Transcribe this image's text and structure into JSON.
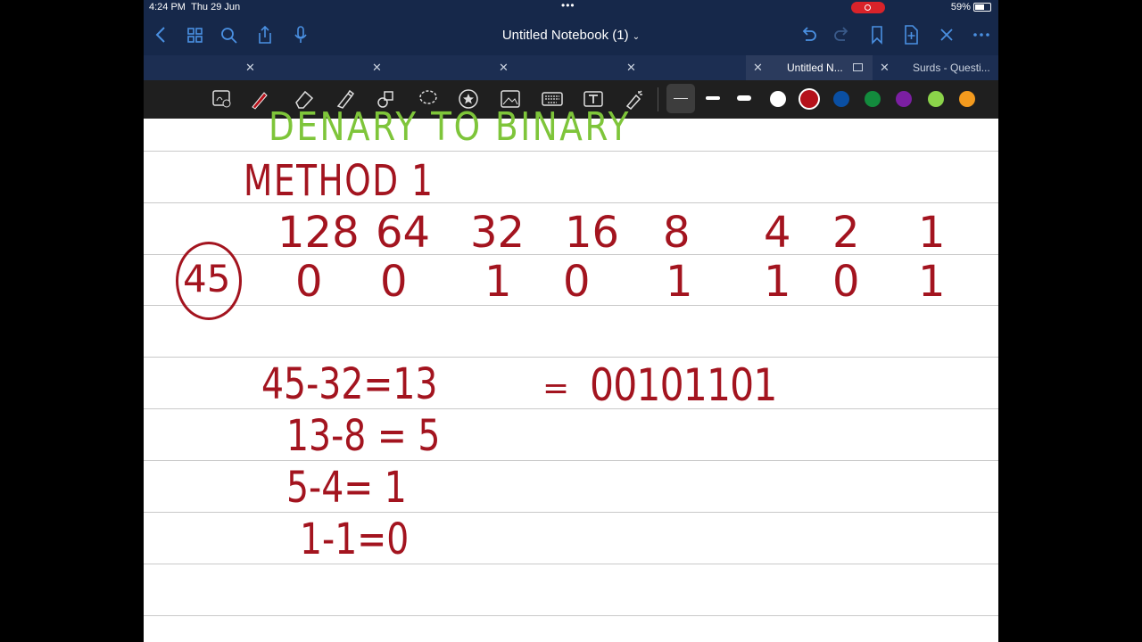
{
  "status": {
    "time": "4:24 PM",
    "date": "Thu 29 Jun",
    "battery": "59%"
  },
  "nav": {
    "title": "Untitled Notebook (1)"
  },
  "tabs": [
    {
      "label": ""
    },
    {
      "label": ""
    },
    {
      "label": ""
    },
    {
      "label": ""
    },
    {
      "label": "Untitled N..."
    },
    {
      "label": "Surds - Questi..."
    }
  ],
  "toolbar": {
    "tools": [
      "lasso-zoom-icon",
      "pen-icon",
      "eraser-icon",
      "highlighter-icon",
      "shapes-icon",
      "lasso-icon",
      "sticker-icon",
      "image-icon",
      "keyboard-icon",
      "text-icon",
      "laser-pointer-icon"
    ],
    "colors": [
      "#ffffff",
      "#b5121b",
      "#0a4fa3",
      "#138b3d",
      "#7b1fa2",
      "#8bd34a",
      "#f39a1e"
    ]
  },
  "notes": {
    "heading": "DENARY TO BINARY",
    "method": "METHOD 1",
    "place_values": [
      "128",
      "64",
      "32",
      "16",
      "8",
      "4",
      "2",
      "1"
    ],
    "decimal": "45",
    "bits": [
      "0",
      "0",
      "1",
      "0",
      "1",
      "1",
      "0",
      "1"
    ],
    "steps": [
      "45-32=13",
      "13-8 = 5",
      "5-4= 1",
      "1-1=0"
    ],
    "result_eq": "=",
    "result": "00101101"
  }
}
